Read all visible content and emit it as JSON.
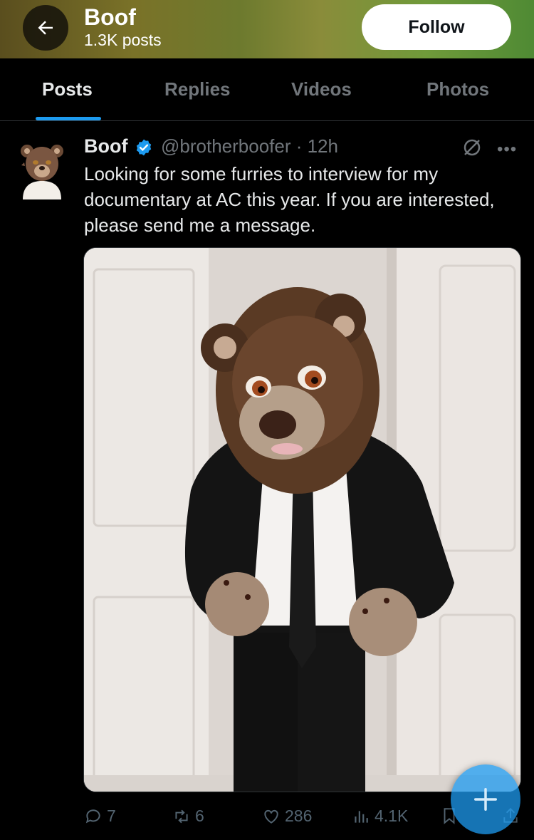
{
  "header": {
    "title": "Boof",
    "post_count": "1.3K posts",
    "follow_label": "Follow"
  },
  "tabs": [
    {
      "label": "Posts",
      "active": true
    },
    {
      "label": "Replies",
      "active": false
    },
    {
      "label": "Videos",
      "active": false
    },
    {
      "label": "Photos",
      "active": false
    }
  ],
  "post": {
    "author_name": "Boof",
    "handle_time": "@brotherboofer · 12h",
    "text": "Looking for some furries to interview for my documentary at AC this year. If you are interested, please send me a message.",
    "verified_color": "#1d9bf0"
  },
  "actions": {
    "replies": "7",
    "reposts": "6",
    "likes": "286",
    "views": "4.1K"
  },
  "colors": {
    "accent": "#1d9bf0",
    "muted": "#71767b"
  },
  "icons": [
    "back-arrow-icon",
    "verified-badge-icon",
    "grok-icon",
    "more-icon",
    "reply-icon",
    "repost-icon",
    "like-icon",
    "views-icon",
    "bookmark-icon",
    "share-icon",
    "compose-plus-icon"
  ]
}
